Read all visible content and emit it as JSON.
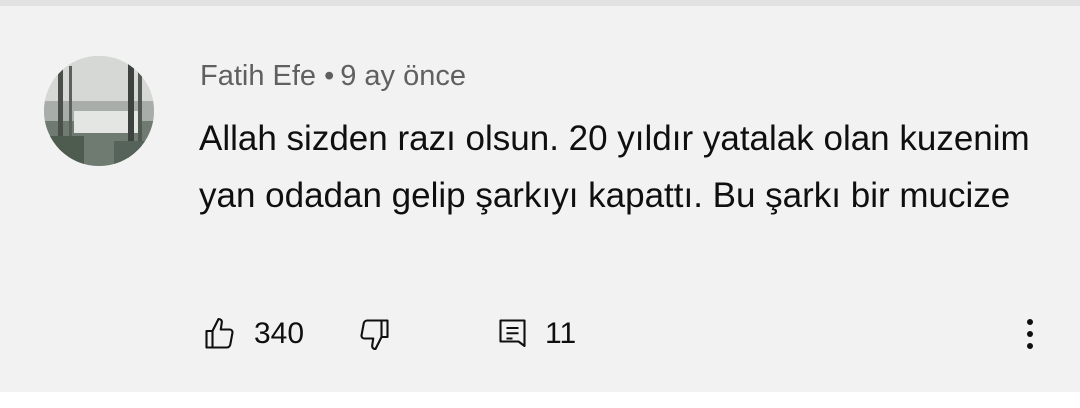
{
  "comment": {
    "author": "Fatih Efe",
    "separator": "•",
    "timestamp": "9 ay önce",
    "text": "Allah sizden razı olsun. 20 yıldır yatalak olan kuzenim yan odadan gelip şarkıyı kapattı. Bu şarkı bir mucize"
  },
  "actions": {
    "like_count": "340",
    "reply_count": "11",
    "like_icon": "thumbs-up-icon",
    "dislike_icon": "thumbs-down-icon",
    "reply_icon": "comment-icon",
    "more_icon": "more-vertical-icon"
  },
  "colors": {
    "background": "#f2f2f2",
    "text": "#0f0f0f",
    "meta": "#606060"
  }
}
